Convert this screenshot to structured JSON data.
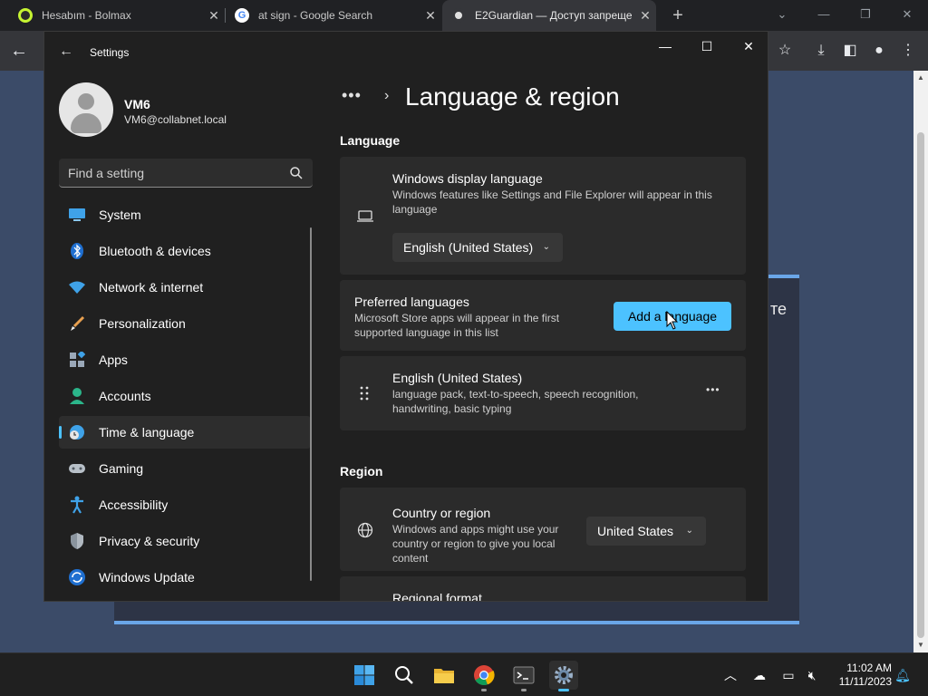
{
  "browser": {
    "tabs": [
      {
        "title": "Hesabım - Bolmax",
        "favicon_color": "#2b2b2b"
      },
      {
        "title": "at sign - Google Search",
        "favicon_color": "#ffffff"
      },
      {
        "title": "E2Guardian — Доступ запреще",
        "favicon_color": "#e0e0e0"
      }
    ],
    "active_tab": 2,
    "new_tab": "+",
    "page_card_text": "те"
  },
  "window": {
    "title": "Settings",
    "back": "←",
    "minimize": "—",
    "maximize": "☐",
    "close": "✕"
  },
  "profile": {
    "name": "VM6",
    "email": "VM6@collabnet.local"
  },
  "search": {
    "placeholder": "Find a setting"
  },
  "nav": {
    "items": [
      {
        "label": "System",
        "icon": "system-icon"
      },
      {
        "label": "Bluetooth & devices",
        "icon": "bluetooth-icon"
      },
      {
        "label": "Network & internet",
        "icon": "wifi-icon"
      },
      {
        "label": "Personalization",
        "icon": "brush-icon"
      },
      {
        "label": "Apps",
        "icon": "apps-icon"
      },
      {
        "label": "Accounts",
        "icon": "accounts-icon"
      },
      {
        "label": "Time & language",
        "icon": "time-language-icon"
      },
      {
        "label": "Gaming",
        "icon": "gaming-icon"
      },
      {
        "label": "Accessibility",
        "icon": "accessibility-icon"
      },
      {
        "label": "Privacy & security",
        "icon": "shield-icon"
      },
      {
        "label": "Windows Update",
        "icon": "update-icon"
      }
    ],
    "selected": 6
  },
  "breadcrumb": {
    "dots": "•••",
    "chevron": "›",
    "title": "Language & region"
  },
  "language": {
    "section": "Language",
    "display": {
      "title": "Windows display language",
      "desc": "Windows features like Settings and File Explorer will appear in this language",
      "value": "English (United States)"
    },
    "preferred": {
      "title": "Preferred languages",
      "desc": "Microsoft Store apps will appear in the first supported language in this list",
      "button": "Add a language"
    },
    "entry": {
      "title": "English (United States)",
      "desc": "language pack, text-to-speech, speech recognition, handwriting, basic typing",
      "more": "•••"
    }
  },
  "region": {
    "section": "Region",
    "country": {
      "title": "Country or region",
      "desc": "Windows and apps might use your country or region to give you local content",
      "value": "United States"
    },
    "format": {
      "title": "Regional format"
    }
  },
  "taskbar": {
    "time": "11:02 AM",
    "date": "11/11/2023"
  },
  "colors": {
    "accent": "#4cc2ff",
    "window_bg": "#202020",
    "card_bg": "#2b2b2b"
  }
}
